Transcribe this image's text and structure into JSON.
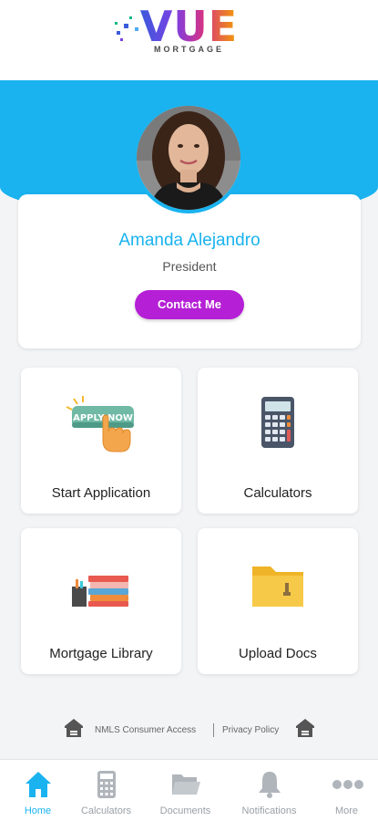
{
  "brand": {
    "logo_word": "VUE",
    "logo_sub": "MORTGAGE"
  },
  "profile": {
    "name": "Amanda Alejandro",
    "title": "President",
    "contact_label": "Contact Me"
  },
  "tiles": [
    {
      "label": "Start Application",
      "icon": "apply-now-icon",
      "icon_text": "APPLY NOW"
    },
    {
      "label": "Calculators",
      "icon": "calculator-icon"
    },
    {
      "label": "Mortgage Library",
      "icon": "books-icon"
    },
    {
      "label": "Upload Docs",
      "icon": "folder-icon"
    }
  ],
  "footer": {
    "nmls_label": "NMLS Consumer Access",
    "privacy_label": "Privacy Policy"
  },
  "nav": {
    "items": [
      {
        "label": "Home",
        "icon": "home-icon",
        "active": true
      },
      {
        "label": "Calculators",
        "icon": "calculator-icon"
      },
      {
        "label": "Documents",
        "icon": "folder-icon"
      },
      {
        "label": "Notifications",
        "icon": "bell-icon"
      },
      {
        "label": "More",
        "icon": "more-icon"
      }
    ]
  },
  "colors": {
    "accent_blue": "#1ab3ef",
    "contact_button": "#b51fd6",
    "nav_inactive": "#9aa0a6"
  }
}
